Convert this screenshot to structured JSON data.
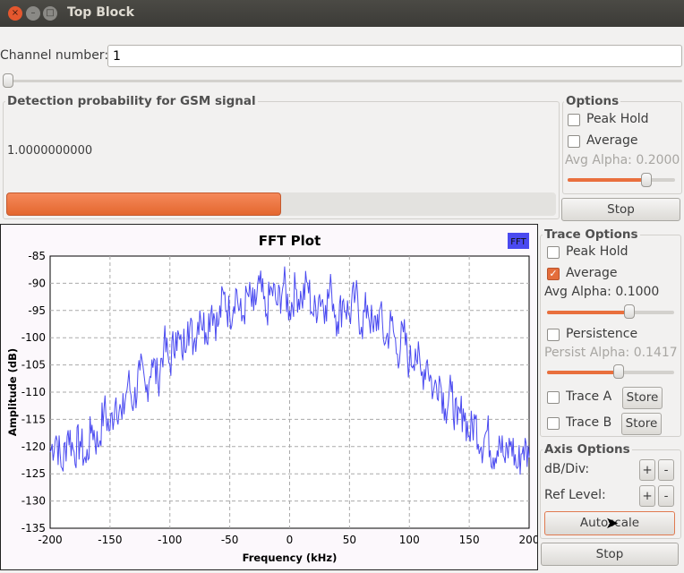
{
  "window": {
    "title": "Top Block"
  },
  "channel": {
    "label": "Channel number:",
    "value": "1",
    "slider_fraction": 0.0
  },
  "detection": {
    "title": "Detection probability for GSM signal",
    "value": "1.0000000000",
    "progress_percent": 50
  },
  "options": {
    "title": "Options",
    "peak_hold": "Peak Hold",
    "peak_hold_checked": false,
    "average": "Average",
    "average_checked": false,
    "avg_alpha": "Avg Alpha: 0.2000",
    "avg_alpha_fraction": 0.8,
    "stop": "Stop"
  },
  "trace_options": {
    "title": "Trace Options",
    "peak_hold": "Peak Hold",
    "average": "Average",
    "avg_alpha": "Avg Alpha: 0.1000",
    "avg_alpha_fraction": 0.65,
    "persistence": "Persistence",
    "persist_alpha": "Persist Alpha: 0.1417",
    "persist_alpha_fraction": 0.55,
    "trace_a": "Trace A",
    "trace_b": "Trace B",
    "store": "Store"
  },
  "axis_options": {
    "title": "Axis Options",
    "db_div": "dB/Div:",
    "ref_level": "Ref Level:",
    "plus": "+",
    "minus": "-",
    "autoscale": "Autoscale",
    "stop": "Stop"
  },
  "colors": {
    "accent": "#e96f3d",
    "trace": "#4a4af0"
  },
  "chart_data": {
    "type": "line",
    "title": "FFT Plot",
    "xlabel": "Frequency (kHz)",
    "ylabel": "Amplitude (dB)",
    "legend": "FFT",
    "legend_position": "top-right",
    "grid": true,
    "xlim": [
      -200,
      200
    ],
    "ylim": [
      -135,
      -85
    ],
    "xticks": [
      "-200",
      "-150",
      "-100",
      "-50",
      "0",
      "50",
      "100",
      "150",
      "200"
    ],
    "yticks": [
      "-85",
      "-90",
      "-95",
      "-100",
      "-105",
      "-110",
      "-115",
      "-120",
      "-125",
      "-130",
      "-135"
    ],
    "series": [
      {
        "name": "FFT",
        "x": [
          -200,
          -195,
          -190,
          -185,
          -180,
          -175,
          -170,
          -165,
          -160,
          -155,
          -150,
          -145,
          -140,
          -135,
          -130,
          -125,
          -120,
          -115,
          -110,
          -105,
          -100,
          -95,
          -90,
          -85,
          -80,
          -75,
          -70,
          -65,
          -60,
          -55,
          -50,
          -45,
          -40,
          -35,
          -30,
          -25,
          -20,
          -15,
          -10,
          -5,
          0,
          5,
          10,
          15,
          20,
          25,
          30,
          35,
          40,
          45,
          50,
          55,
          60,
          65,
          70,
          75,
          80,
          85,
          90,
          95,
          100,
          105,
          110,
          115,
          120,
          125,
          130,
          135,
          140,
          145,
          150,
          155,
          160,
          165,
          170,
          175,
          180,
          185,
          190,
          195,
          200
        ],
        "y": [
          -121,
          -118,
          -124,
          -117,
          -121,
          -119,
          -123,
          -116,
          -120,
          -113,
          -117,
          -111,
          -115,
          -108,
          -112,
          -106,
          -110,
          -104,
          -108,
          -101,
          -105,
          -99,
          -103,
          -97,
          -101,
          -95,
          -99,
          -94,
          -98,
          -92,
          -96,
          -91,
          -97,
          -92,
          -95,
          -90,
          -96,
          -91,
          -94,
          -90,
          -95,
          -91,
          -93,
          -90,
          -96,
          -92,
          -94,
          -91,
          -97,
          -93,
          -96,
          -92,
          -98,
          -94,
          -99,
          -95,
          -101,
          -97,
          -103,
          -99,
          -105,
          -102,
          -107,
          -104,
          -110,
          -107,
          -113,
          -110,
          -116,
          -113,
          -118,
          -115,
          -120,
          -117,
          -122,
          -118,
          -123,
          -119,
          -124,
          -120,
          -122
        ]
      }
    ]
  }
}
